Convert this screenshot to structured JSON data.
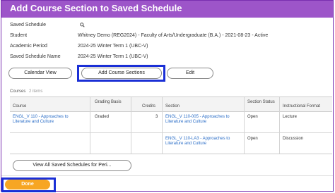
{
  "dialog": {
    "title": "Add Course Section to Saved Schedule"
  },
  "fields": [
    {
      "label": "Saved Schedule",
      "value": ""
    },
    {
      "label": "Student",
      "value": "Whitney Demo (REG2024) - Faculty of Arts/Undergraduate (B.A.) - 2021-08-23 - Active"
    },
    {
      "label": "Academic Period",
      "value": "2024-25 Winter Term 1 (UBC-V)"
    },
    {
      "label": "Saved Schedule Name",
      "value": "2024-25 Winter Term 1 (UBC-V)"
    }
  ],
  "search_icon": "search-icon",
  "buttons": {
    "calendar_view": "Calendar View",
    "add_course_sections": "Add Course Sections",
    "edit": "Edit",
    "view_all": "View All Saved Schedules for Peri...",
    "done": "Done"
  },
  "courses": {
    "label": "Courses",
    "count": "2 items",
    "headers": [
      "Course",
      "Grading Basis",
      "Credits",
      "Section",
      "Section Status",
      "Instructional Format"
    ],
    "rows": [
      {
        "course": "ENGL_V 110 - Approaches to Literature and Culture",
        "grading": "Graded",
        "credits": "3",
        "section": "ENGL_V 110-005 - Approaches to Literature and Culture",
        "status": "Open",
        "format": "Lecture"
      },
      {
        "course": "",
        "grading": "",
        "credits": "",
        "section": "ENGL_V 110-LA3 - Approaches to Literature and Culture",
        "status": "Open",
        "format": "Discussion"
      }
    ]
  },
  "colors": {
    "header_bg": "#9d55c9",
    "highlight": "#1a2fd6",
    "done_bg": "#f7a623",
    "link": "#2a6dc7"
  }
}
